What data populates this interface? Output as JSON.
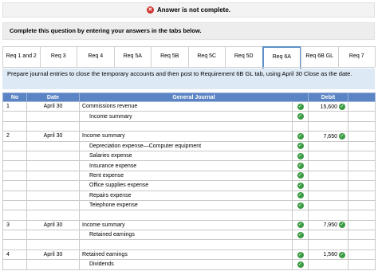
{
  "status": {
    "text": "Answer is not complete."
  },
  "instruction": "Complete this question by entering your answers in the tabs below.",
  "tabs": [
    "Req 1 and 2",
    "Req 3",
    "Req 4",
    "Req 5A",
    "Req 5B",
    "Req 5C",
    "Req 5D",
    "Req 6A",
    "Req 6B GL",
    "Req 7"
  ],
  "active_tab": "Req 6A",
  "description": "Prepare journal entries to close the temporary accounts and then post to Requirement 6B GL tab, using April 30 Close as the date.",
  "table": {
    "headers": {
      "no": "No",
      "date": "Date",
      "journal": "General Journal",
      "debit": "Debit"
    },
    "rows": [
      {
        "no": "1",
        "date": "April 30",
        "account": "Commissions revenue",
        "indent": false,
        "debit": "15,600",
        "check": true
      },
      {
        "no": "",
        "date": "",
        "account": "Income summary",
        "indent": true,
        "debit": "",
        "check": true
      },
      {
        "no": "",
        "date": "",
        "account": "",
        "indent": false,
        "debit": "",
        "check": false
      },
      {
        "no": "2",
        "date": "April 30",
        "account": "Income summary",
        "indent": false,
        "debit": "7,650",
        "check": true
      },
      {
        "no": "",
        "date": "",
        "account": "Depreciation expense—Computer equipment",
        "indent": true,
        "debit": "",
        "check": true
      },
      {
        "no": "",
        "date": "",
        "account": "Salaries expense",
        "indent": true,
        "debit": "",
        "check": true
      },
      {
        "no": "",
        "date": "",
        "account": "Insurance expense",
        "indent": true,
        "debit": "",
        "check": true
      },
      {
        "no": "",
        "date": "",
        "account": "Rent expense",
        "indent": true,
        "debit": "",
        "check": true
      },
      {
        "no": "",
        "date": "",
        "account": "Office supplies expense",
        "indent": true,
        "debit": "",
        "check": true
      },
      {
        "no": "",
        "date": "",
        "account": "Repairs expense",
        "indent": true,
        "debit": "",
        "check": true
      },
      {
        "no": "",
        "date": "",
        "account": "Telephone expense",
        "indent": true,
        "debit": "",
        "check": true
      },
      {
        "no": "",
        "date": "",
        "account": "",
        "indent": false,
        "debit": "",
        "check": false
      },
      {
        "no": "3",
        "date": "April 30",
        "account": "Income summary",
        "indent": false,
        "debit": "7,950",
        "check": true
      },
      {
        "no": "",
        "date": "",
        "account": "Retained earnings",
        "indent": true,
        "debit": "",
        "check": true
      },
      {
        "no": "",
        "date": "",
        "account": "",
        "indent": false,
        "debit": "",
        "check": false
      },
      {
        "no": "4",
        "date": "April 30",
        "account": "Retained earnings",
        "indent": false,
        "debit": "1,560",
        "check": true
      },
      {
        "no": "",
        "date": "",
        "account": "Dividends",
        "indent": true,
        "debit": "",
        "check": true
      }
    ]
  },
  "colors": {
    "header": "#5b84c4",
    "check": "#3a9b43",
    "error": "#d0312d",
    "desc_bg": "#dde9f5"
  }
}
